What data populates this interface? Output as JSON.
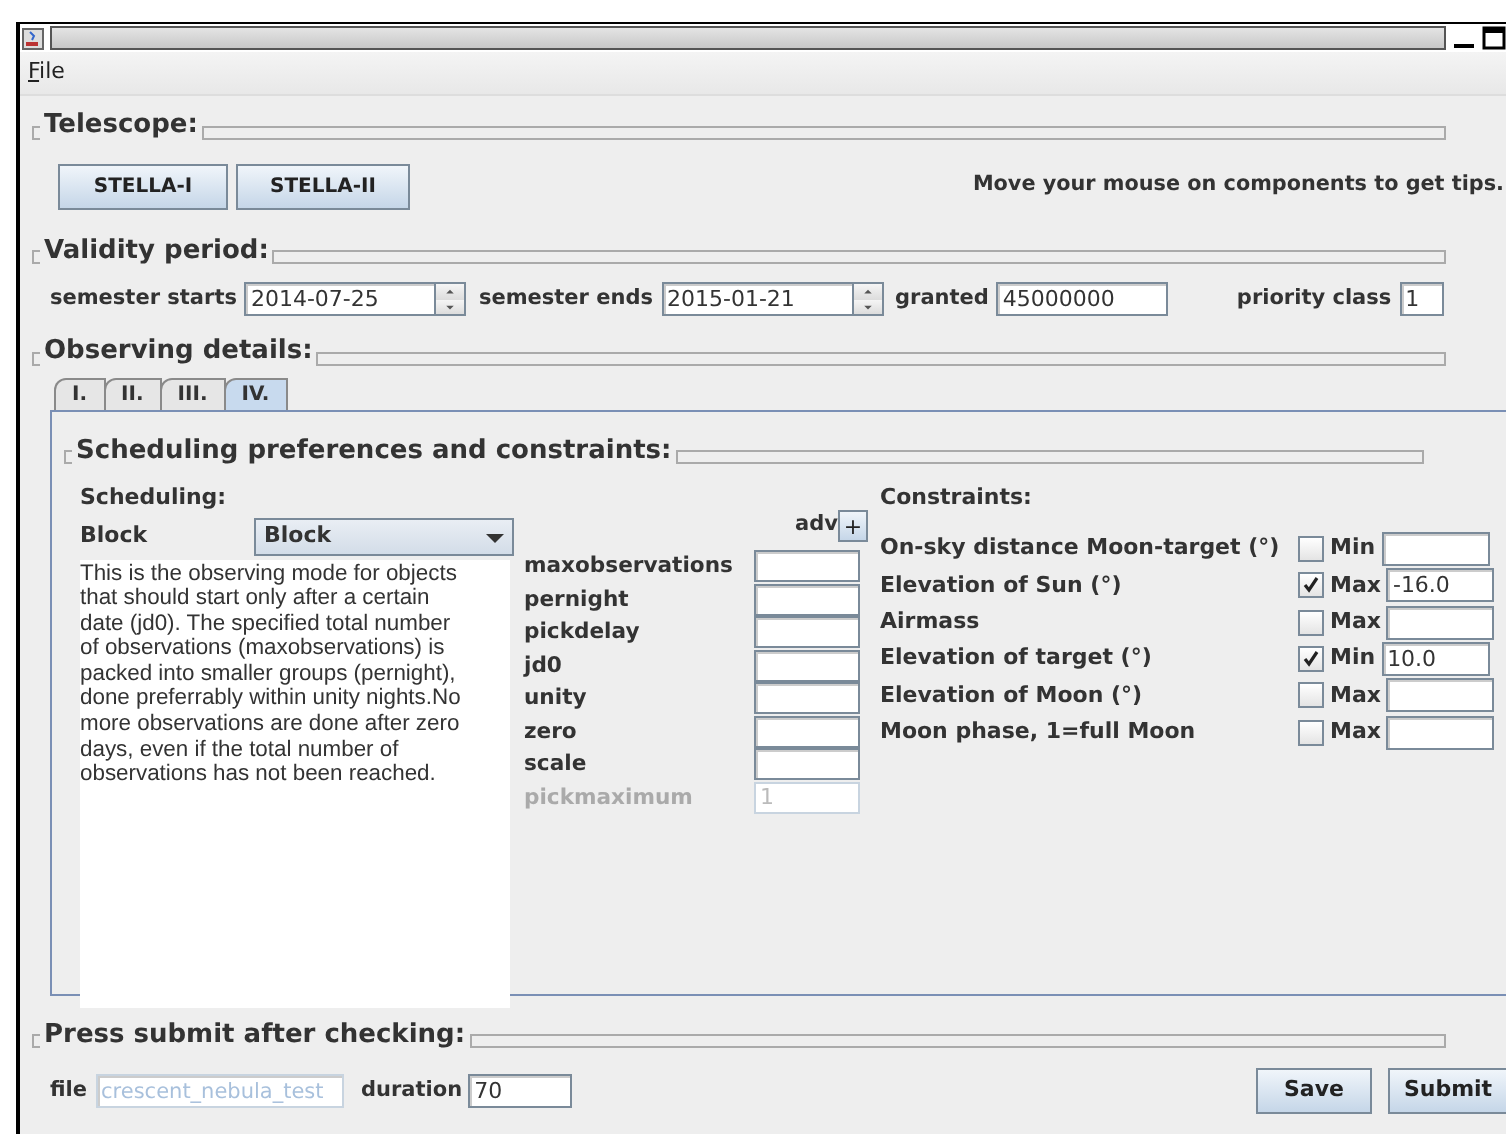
{
  "menu": [
    {
      "label": "File"
    }
  ],
  "telescope": {
    "title": "Telescope:",
    "buttons": [
      "STELLA-I",
      "STELLA-II"
    ],
    "tip": "Move your mouse on components to get tips."
  },
  "validity": {
    "title": "Validity period:",
    "fields": [
      {
        "kind": "spinner",
        "label": "semester starts",
        "value": "2014-07-25"
      },
      {
        "kind": "spinner",
        "label": "semester ends",
        "value": "2015-01-21"
      },
      {
        "kind": "text",
        "label": "granted",
        "value": "45000000"
      },
      {
        "kind": "text",
        "label": "priority class",
        "value": "1"
      }
    ]
  },
  "observing": {
    "title": "Observing details:",
    "tabs": [
      {
        "label": "I.",
        "selected": false
      },
      {
        "label": "II.",
        "selected": false
      },
      {
        "label": "III.",
        "selected": false
      },
      {
        "label": "IV.",
        "selected": true
      }
    ]
  },
  "panel": {
    "title": "Scheduling preferences and constraints:",
    "scheduling": {
      "title": "Scheduling:",
      "mode_label": "Block",
      "mode_value": "Block",
      "adv_label": "adv",
      "adv_button": "+",
      "description_lines": [
        "This is the observing mode for objects",
        "that should start only after a certain",
        "date (jd0). The specified total number",
        "of observations (maxobservations) is",
        "packed into smaller groups (pernight),",
        "done preferrably within unity nights.No",
        "more observations are done after zero",
        "days, even if the total number of",
        "observations has not been reached."
      ],
      "params": [
        {
          "label": "maxobservations",
          "disabled": false
        },
        {
          "label": "pernight",
          "disabled": false
        },
        {
          "label": "pickdelay",
          "disabled": false
        },
        {
          "label": "jd0",
          "disabled": false
        },
        {
          "label": "unity",
          "disabled": false
        },
        {
          "label": "zero",
          "disabled": false
        },
        {
          "label": "scale",
          "disabled": false
        },
        {
          "label": "pickmaximum",
          "value": "1",
          "disabled": true
        }
      ]
    },
    "constraints": {
      "title": "Constraints:",
      "rows": [
        {
          "label": "On-sky distance Moon-target (°)",
          "checked": false,
          "bound": "Min"
        },
        {
          "label": "Elevation of Sun (°)",
          "checked": true,
          "bound": "Max",
          "value": "-16.0"
        },
        {
          "label": "Airmass",
          "checked": false,
          "bound": "Max"
        },
        {
          "label": "Elevation of target (°)",
          "checked": true,
          "bound": "Min",
          "value": "10.0"
        },
        {
          "label": "Elevation of Moon (°)",
          "checked": false,
          "bound": "Max"
        },
        {
          "label": "Moon phase, 1=full Moon",
          "checked": false,
          "bound": "Max"
        }
      ]
    }
  },
  "submit": {
    "title": "Press submit after checking:",
    "file_label": "file",
    "file_value": "crescent_nebula_test",
    "file_disabled": true,
    "duration_label": "duration",
    "duration_value": "70",
    "buttons": [
      "Save",
      "Submit"
    ]
  }
}
